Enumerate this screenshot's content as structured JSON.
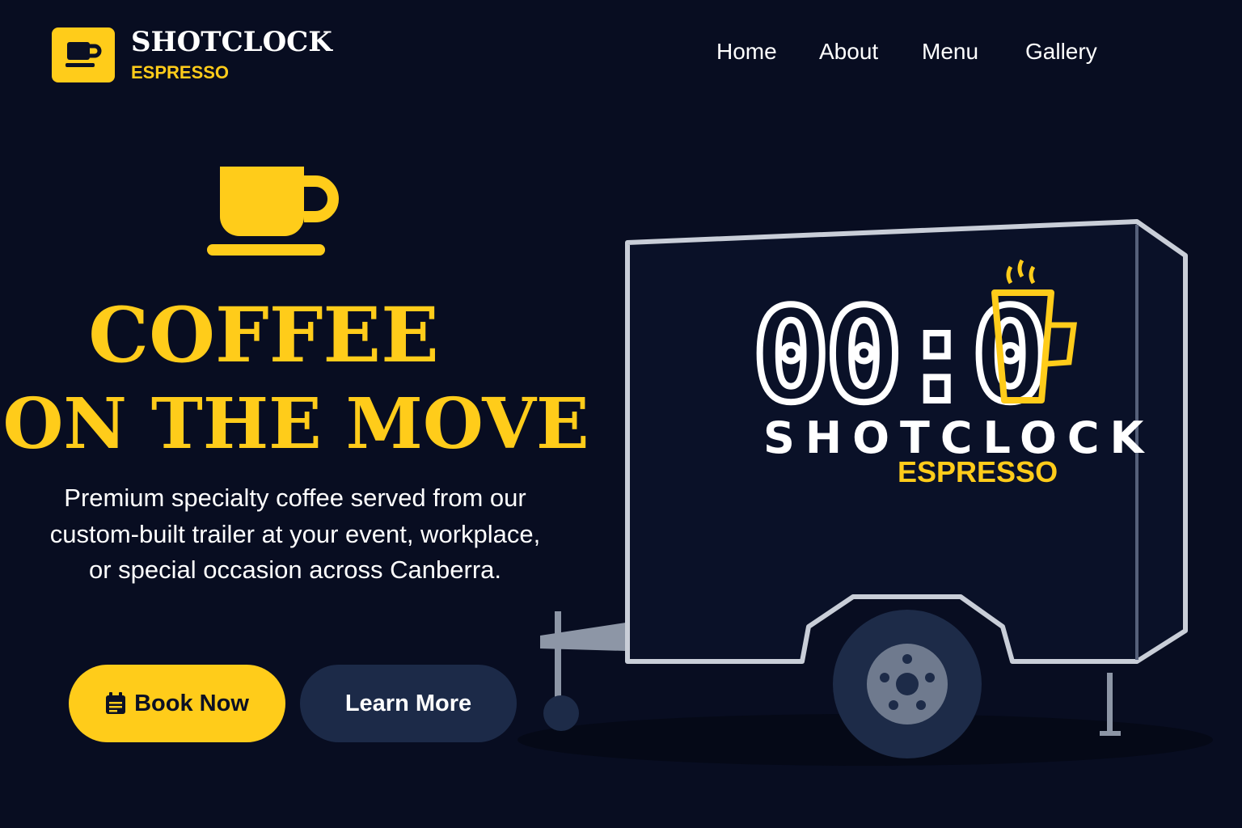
{
  "brand": {
    "title": "SHOTCLOCK",
    "subtitle": "ESPRESSO",
    "icon": "coffee-cup-icon"
  },
  "nav": {
    "items": [
      "Home",
      "About",
      "Menu",
      "Gallery"
    ]
  },
  "hero": {
    "icon": "coffee-cup-icon",
    "headline_line1": "COFFEE",
    "headline_line2": "ON THE MOVE",
    "description": "Premium specialty coffee served from our custom-built trailer at your event, workplace, or special occasion across Canberra.",
    "book_label": "Book Now",
    "book_icon": "calendar-icon",
    "learn_label": "Learn More"
  },
  "trailer": {
    "clock_text": "00:0",
    "brand_title": "SHOTCLOCK",
    "brand_subtitle": "ESPRESSO",
    "cup_icon": "steaming-cup-icon"
  },
  "colors": {
    "background": "#080d21",
    "accent": "#ffcc1a",
    "secondary_button": "#1c2a48",
    "trailer_outline": "#c9ced8"
  }
}
